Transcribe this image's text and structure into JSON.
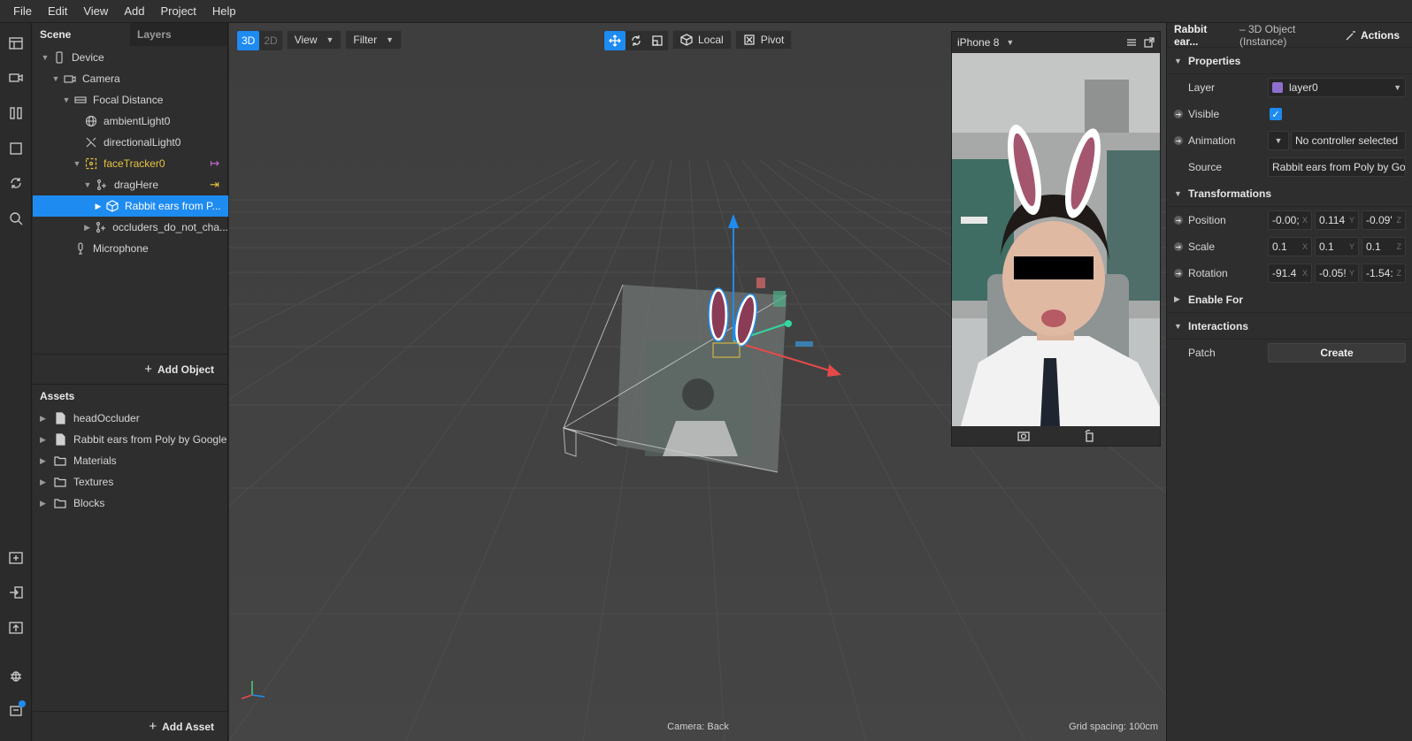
{
  "menu": [
    "File",
    "Edit",
    "View",
    "Add",
    "Project",
    "Help"
  ],
  "rail_icons": [
    "layout-icon",
    "video-icon",
    "columns-icon",
    "square-icon",
    "sync-icon",
    "search-icon",
    "add-folder-icon",
    "import-icon",
    "export-icon",
    "bug-icon",
    "notification-icon"
  ],
  "scene": {
    "tab_scene": "Scene",
    "tab_layers": "Layers",
    "tree": [
      {
        "label": "Device",
        "icon": "phone-icon",
        "depth": 0,
        "expanded": true
      },
      {
        "label": "Camera",
        "icon": "camera-icon",
        "depth": 1,
        "expanded": true
      },
      {
        "label": "Focal Distance",
        "icon": "focal-icon",
        "depth": 2,
        "expanded": true
      },
      {
        "label": "ambientLight0",
        "icon": "globe-icon",
        "depth": 3
      },
      {
        "label": "directionalLight0",
        "icon": "light-icon",
        "depth": 3
      },
      {
        "label": "faceTracker0",
        "icon": "face-tracker-icon",
        "depth": 3,
        "expanded": true,
        "highlight": true,
        "marker": "↦"
      },
      {
        "label": "dragHere",
        "icon": "null-object-icon",
        "depth": 4,
        "expanded": true,
        "marker": "⇥"
      },
      {
        "label": "Rabbit ears from P...",
        "icon": "cube-icon",
        "depth": 5,
        "collapsed": true,
        "selected": true
      },
      {
        "label": "occluders_do_not_cha...",
        "icon": "null-object-icon",
        "depth": 4,
        "collapsed": true
      },
      {
        "label": "Microphone",
        "icon": "microphone-icon",
        "depth": 1
      }
    ],
    "add_object": "Add Object"
  },
  "assets": {
    "title": "Assets",
    "items": [
      {
        "label": "headOccluder",
        "icon": "file-icon"
      },
      {
        "label": "Rabbit ears from Poly by Google",
        "icon": "file-icon"
      },
      {
        "label": "Materials",
        "icon": "folder-icon"
      },
      {
        "label": "Textures",
        "icon": "folder-icon"
      },
      {
        "label": "Blocks",
        "icon": "folder-icon"
      }
    ],
    "add_asset": "Add Asset"
  },
  "viewport": {
    "mode_3d": "3D",
    "mode_2d": "2D",
    "view": "View",
    "filter": "Filter",
    "local": "Local",
    "pivot": "Pivot",
    "camera_label": "Camera: Back",
    "grid_label": "Grid spacing: 100cm"
  },
  "phone": {
    "device": "iPhone 8"
  },
  "inspector": {
    "object_name": "Rabbit ear...",
    "object_type": "– 3D Object (Instance)",
    "actions": "Actions",
    "sections": {
      "properties": "Properties",
      "transformations": "Transformations",
      "enable_for": "Enable For",
      "interactions": "Interactions"
    },
    "layer_label": "Layer",
    "layer_value": "layer0",
    "layer_color": "#8e6fd0",
    "visible_label": "Visible",
    "animation_label": "Animation",
    "animation_value": "No controller selected",
    "source_label": "Source",
    "source_value": "Rabbit ears from Poly by Go...",
    "position_label": "Position",
    "position": [
      "-0.00;",
      "0.114",
      "-0.09'"
    ],
    "scale_label": "Scale",
    "scale": [
      "0.1",
      "0.1",
      "0.1"
    ],
    "rotation_label": "Rotation",
    "rotation": [
      "-91.4",
      "-0.05!",
      "-1.54:"
    ],
    "axes": [
      "X",
      "Y",
      "Z"
    ],
    "patch_label": "Patch",
    "create_label": "Create"
  },
  "colors": {
    "accent": "#1e8bf0",
    "highlight": "#e7c341",
    "panel": "#2e2e2e"
  }
}
